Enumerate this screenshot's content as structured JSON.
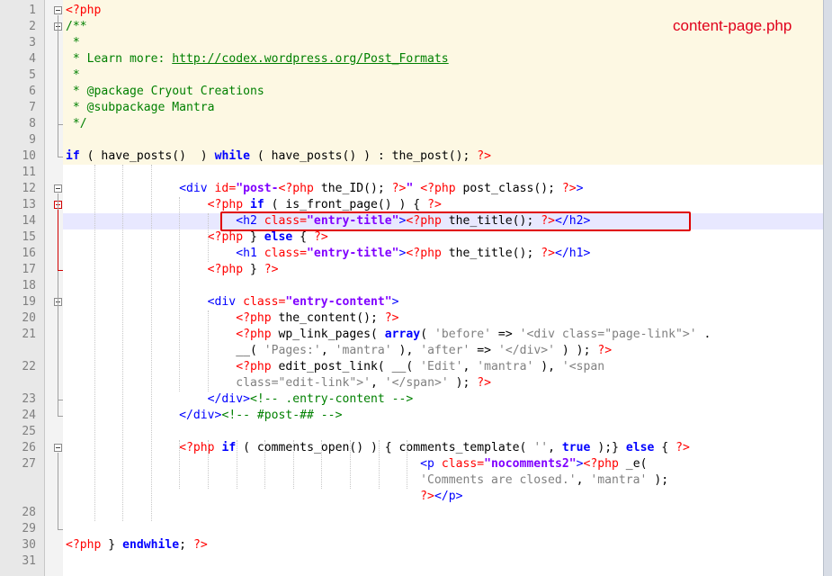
{
  "editor": {
    "file_label": "content-page.php",
    "colors": {
      "php_block_bg": "#fdf8e3",
      "current_line_bg": "#e8e8ff",
      "annotation_red": "#e00000",
      "keyword_blue": "#0000ff",
      "comment_green": "#008000",
      "string_purple": "#8000ff"
    },
    "line_numbers": [
      "1",
      "2",
      "3",
      "4",
      "5",
      "6",
      "7",
      "8",
      "9",
      "10",
      "11",
      "12",
      "13",
      "14",
      "15",
      "16",
      "17",
      "18",
      "19",
      "20",
      "21",
      "",
      "22",
      "",
      "23",
      "24",
      "25",
      "26",
      "27",
      "",
      "",
      "28",
      "29",
      "30",
      "31"
    ],
    "code_lines": [
      [
        {
          "t": "<?php",
          "c": "php"
        }
      ],
      [
        {
          "t": "/**",
          "c": "com"
        }
      ],
      [
        {
          "t": " *",
          "c": "com"
        }
      ],
      [
        {
          "t": " * Learn more: ",
          "c": "com"
        },
        {
          "t": "http://codex.wordpress.org/Post_Formats",
          "c": "url"
        }
      ],
      [
        {
          "t": " *",
          "c": "com"
        }
      ],
      [
        {
          "t": " * @package Cryout Creations",
          "c": "com"
        }
      ],
      [
        {
          "t": " * @subpackage Mantra",
          "c": "com"
        }
      ],
      [
        {
          "t": " */",
          "c": "com"
        }
      ],
      [],
      [
        {
          "t": "if",
          "c": "kw"
        },
        {
          "t": " ( have_posts()  ) ",
          "c": ""
        },
        {
          "t": "while",
          "c": "kw"
        },
        {
          "t": " ( have_posts() ) : the_post(); ",
          "c": ""
        },
        {
          "t": "?>",
          "c": "php"
        }
      ],
      [],
      [
        {
          "t": "                <div ",
          "c": "tag"
        },
        {
          "t": "id=",
          "c": "attr"
        },
        {
          "t": "\"post-",
          "c": "str"
        },
        {
          "t": "<?php",
          "c": "php"
        },
        {
          "t": " the_ID(); ",
          "c": ""
        },
        {
          "t": "?>",
          "c": "php"
        },
        {
          "t": "\"",
          "c": "str"
        },
        {
          "t": " ",
          "c": ""
        },
        {
          "t": "<?php",
          "c": "php"
        },
        {
          "t": " post_class(); ",
          "c": ""
        },
        {
          "t": "?>",
          "c": "php"
        },
        {
          "t": ">",
          "c": "tag"
        }
      ],
      [
        {
          "t": "                    ",
          "c": ""
        },
        {
          "t": "<?php",
          "c": "php"
        },
        {
          "t": " ",
          "c": ""
        },
        {
          "t": "if",
          "c": "kw"
        },
        {
          "t": " ( is_front_page() ) { ",
          "c": ""
        },
        {
          "t": "?>",
          "c": "php"
        }
      ],
      [
        {
          "t": "                        <h2 ",
          "c": "tag"
        },
        {
          "t": "class=",
          "c": "attr"
        },
        {
          "t": "\"entry-title\"",
          "c": "str"
        },
        {
          "t": ">",
          "c": "tag"
        },
        {
          "t": "<?php",
          "c": "php"
        },
        {
          "t": " the_title(); ",
          "c": ""
        },
        {
          "t": "?>",
          "c": "php"
        },
        {
          "t": "</h2>",
          "c": "tag"
        }
      ],
      [
        {
          "t": "                    ",
          "c": ""
        },
        {
          "t": "<?php",
          "c": "php"
        },
        {
          "t": " } ",
          "c": ""
        },
        {
          "t": "else",
          "c": "kw"
        },
        {
          "t": " { ",
          "c": ""
        },
        {
          "t": "?>",
          "c": "php"
        }
      ],
      [
        {
          "t": "                        <h1 ",
          "c": "tag"
        },
        {
          "t": "class=",
          "c": "attr"
        },
        {
          "t": "\"entry-title\"",
          "c": "str"
        },
        {
          "t": ">",
          "c": "tag"
        },
        {
          "t": "<?php",
          "c": "php"
        },
        {
          "t": " the_title(); ",
          "c": ""
        },
        {
          "t": "?>",
          "c": "php"
        },
        {
          "t": "</h1>",
          "c": "tag"
        }
      ],
      [
        {
          "t": "                    ",
          "c": ""
        },
        {
          "t": "<?php",
          "c": "php"
        },
        {
          "t": " } ",
          "c": ""
        },
        {
          "t": "?>",
          "c": "php"
        }
      ],
      [],
      [
        {
          "t": "                    <div ",
          "c": "tag"
        },
        {
          "t": "class=",
          "c": "attr"
        },
        {
          "t": "\"entry-content\"",
          "c": "str"
        },
        {
          "t": ">",
          "c": "tag"
        }
      ],
      [
        {
          "t": "                        ",
          "c": ""
        },
        {
          "t": "<?php",
          "c": "php"
        },
        {
          "t": " the_content(); ",
          "c": ""
        },
        {
          "t": "?>",
          "c": "php"
        }
      ],
      [
        {
          "t": "                        ",
          "c": ""
        },
        {
          "t": "<?php",
          "c": "php"
        },
        {
          "t": " wp_link_pages( ",
          "c": ""
        },
        {
          "t": "array",
          "c": "kw"
        },
        {
          "t": "( ",
          "c": ""
        },
        {
          "t": "'before'",
          "c": "sstr"
        },
        {
          "t": " => ",
          "c": ""
        },
        {
          "t": "'<div class=\"page-link\">'",
          "c": "sstr"
        },
        {
          "t": " .",
          "c": ""
        }
      ],
      [
        {
          "t": "                        __( ",
          "c": ""
        },
        {
          "t": "'Pages:'",
          "c": "sstr"
        },
        {
          "t": ", ",
          "c": ""
        },
        {
          "t": "'mantra'",
          "c": "sstr"
        },
        {
          "t": " ), ",
          "c": ""
        },
        {
          "t": "'after'",
          "c": "sstr"
        },
        {
          "t": " => ",
          "c": ""
        },
        {
          "t": "'</div>'",
          "c": "sstr"
        },
        {
          "t": " ) ); ",
          "c": ""
        },
        {
          "t": "?>",
          "c": "php"
        }
      ],
      [
        {
          "t": "                        ",
          "c": ""
        },
        {
          "t": "<?php",
          "c": "php"
        },
        {
          "t": " edit_post_link( __( ",
          "c": ""
        },
        {
          "t": "'Edit'",
          "c": "sstr"
        },
        {
          "t": ", ",
          "c": ""
        },
        {
          "t": "'mantra'",
          "c": "sstr"
        },
        {
          "t": " ), ",
          "c": ""
        },
        {
          "t": "'<span",
          "c": "sstr"
        }
      ],
      [
        {
          "t": "                        ",
          "c": ""
        },
        {
          "t": "class=\"edit-link\">'",
          "c": "sstr"
        },
        {
          "t": ", ",
          "c": ""
        },
        {
          "t": "'</span>'",
          "c": "sstr"
        },
        {
          "t": " ); ",
          "c": ""
        },
        {
          "t": "?>",
          "c": "php"
        }
      ],
      [
        {
          "t": "                    </div>",
          "c": "tag"
        },
        {
          "t": "<!-- .entry-content -->",
          "c": "cmt"
        }
      ],
      [
        {
          "t": "                </div>",
          "c": "tag"
        },
        {
          "t": "<!-- #post-## -->",
          "c": "cmt"
        }
      ],
      [],
      [
        {
          "t": "                ",
          "c": ""
        },
        {
          "t": "<?php",
          "c": "php"
        },
        {
          "t": " ",
          "c": ""
        },
        {
          "t": "if",
          "c": "kw"
        },
        {
          "t": " ( comments_open() ) { comments_template( ",
          "c": ""
        },
        {
          "t": "''",
          "c": "sstr"
        },
        {
          "t": ", ",
          "c": ""
        },
        {
          "t": "true",
          "c": "kw"
        },
        {
          "t": " );} ",
          "c": ""
        },
        {
          "t": "else",
          "c": "kw"
        },
        {
          "t": " { ",
          "c": ""
        },
        {
          "t": "?>",
          "c": "php"
        }
      ],
      [
        {
          "t": "                                                  <p ",
          "c": "tag"
        },
        {
          "t": "class=",
          "c": "attr"
        },
        {
          "t": "\"nocomments2\"",
          "c": "str"
        },
        {
          "t": ">",
          "c": "tag"
        },
        {
          "t": "<?php",
          "c": "php"
        },
        {
          "t": " _e(",
          "c": ""
        }
      ],
      [
        {
          "t": "                                                  ",
          "c": ""
        },
        {
          "t": "'Comments are closed.'",
          "c": "sstr"
        },
        {
          "t": ", ",
          "c": ""
        },
        {
          "t": "'mantra'",
          "c": "sstr"
        },
        {
          "t": " );",
          "c": ""
        }
      ],
      [
        {
          "t": "                                                  ",
          "c": ""
        },
        {
          "t": "?>",
          "c": "php"
        },
        {
          "t": "</p>",
          "c": "tag"
        }
      ],
      [],
      [],
      [
        {
          "t": "<?php",
          "c": "php"
        },
        {
          "t": " } ",
          "c": ""
        },
        {
          "t": "endwhile",
          "c": "kw"
        },
        {
          "t": "; ",
          "c": ""
        },
        {
          "t": "?>",
          "c": "php"
        }
      ],
      []
    ]
  }
}
